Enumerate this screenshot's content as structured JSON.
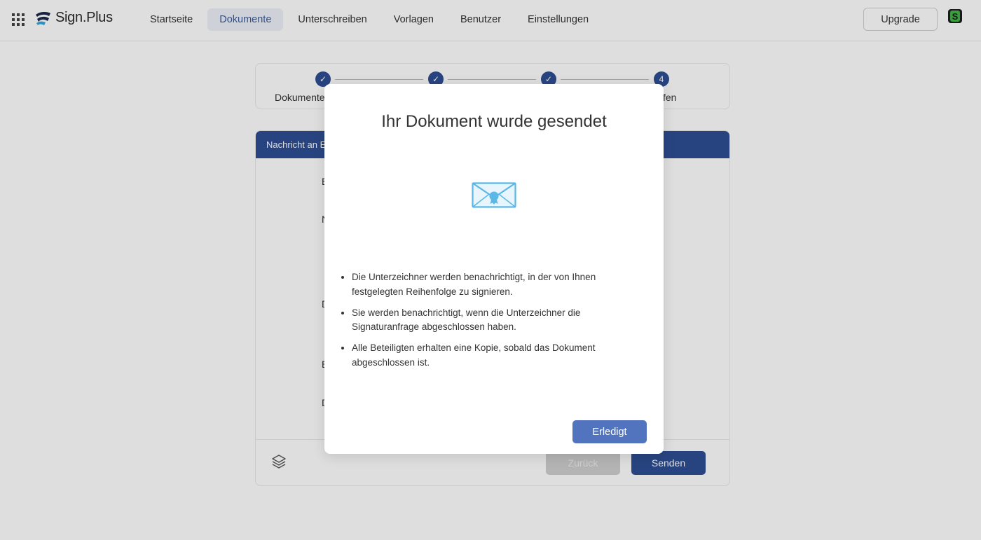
{
  "header": {
    "brand": "Sign.Plus",
    "nav": [
      {
        "label": "Startseite",
        "active": false
      },
      {
        "label": "Dokumente",
        "active": true
      },
      {
        "label": "Unterschreiben",
        "active": false
      },
      {
        "label": "Vorlagen",
        "active": false
      },
      {
        "label": "Benutzer",
        "active": false
      },
      {
        "label": "Einstellungen",
        "active": false
      }
    ],
    "upgrade_label": "Upgrade"
  },
  "stepper": {
    "steps": [
      {
        "state": "done",
        "label": "Dokumente"
      },
      {
        "state": "done",
        "label": ""
      },
      {
        "state": "done",
        "label": ""
      },
      {
        "state": "current",
        "number": "4",
        "label": "fen"
      }
    ]
  },
  "form": {
    "header_label": "Nachricht an E",
    "field_letters": [
      "E",
      "N",
      "D",
      "E",
      "D"
    ],
    "back_label": "Zurück",
    "send_label": "Senden"
  },
  "modal": {
    "title": "Ihr Dokument wurde gesendet",
    "bullets": [
      "Die Unterzeichner werden benachrichtigt, in der von Ihnen festgelegten Reihenfolge zu signieren.",
      "Sie werden benachrichtigt, wenn die Unterzeichner die Signaturanfrage abgeschlossen haben.",
      "Alle Beteiligten erhalten eine Kopie, sobald das Dokument abgeschlossen ist."
    ],
    "done_label": "Erledigt"
  },
  "colors": {
    "primary": "#2f4f93",
    "modal_button": "#5274be",
    "envelope": "#5bb8e6"
  }
}
